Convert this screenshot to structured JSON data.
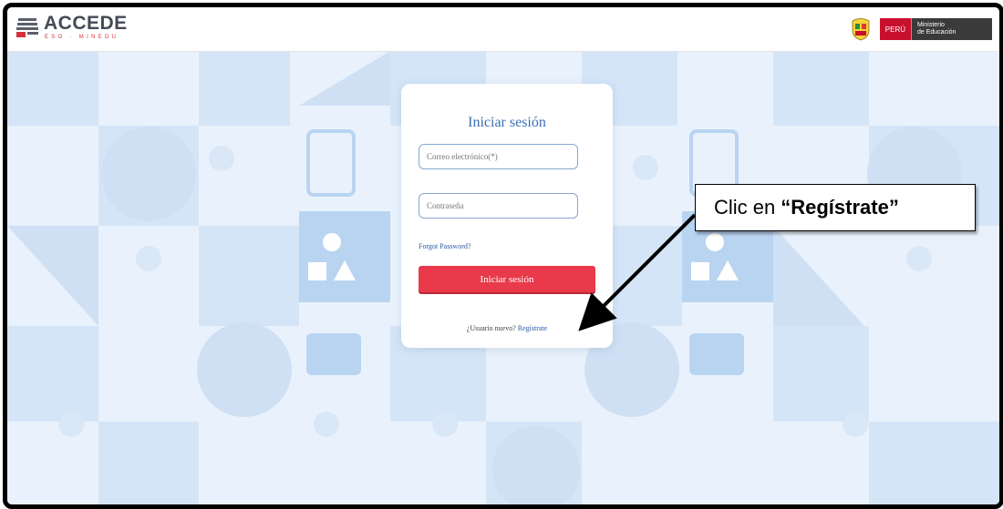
{
  "header": {
    "logo_text": "ACCEDE",
    "logo_subtitle": "ESO · MINEDU",
    "gov_country": "PERÚ",
    "gov_ministry_line1": "Ministerio",
    "gov_ministry_line2": "de Educación"
  },
  "login": {
    "title": "Iniciar sesión",
    "email_placeholder": "Correo electrónico(*)",
    "password_placeholder": "Contraseña",
    "forgot_label": "Forgot Password?",
    "submit_label": "Iniciar sesión",
    "new_user_text": "¿Usuario nuevo?",
    "register_link": "Regístrate"
  },
  "annotation": {
    "prefix": "Clic en",
    "emphasis": "“Regístrate”"
  },
  "colors": {
    "accent_red": "#e83a4a",
    "link_blue": "#2a5aa5",
    "title_blue": "#3b6fb6",
    "background": "#e6f0fb"
  },
  "icons": [
    "accede-logo-icon",
    "peru-shield-icon",
    "arrow-icon"
  ]
}
